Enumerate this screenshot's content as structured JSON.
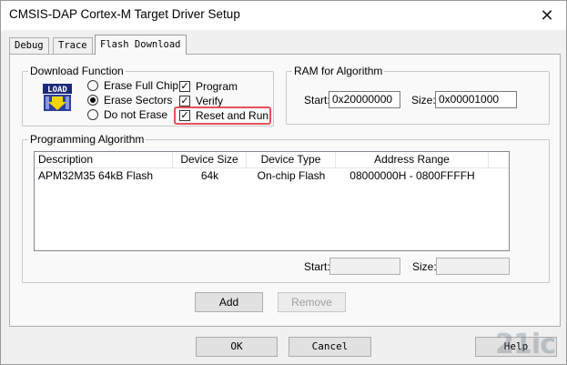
{
  "window": {
    "title": "CMSIS-DAP Cortex-M Target Driver Setup",
    "close_glyph": "✕"
  },
  "tabs": [
    {
      "label": "Debug",
      "active": false
    },
    {
      "label": "Trace",
      "active": false
    },
    {
      "label": "Flash Download",
      "active": true
    }
  ],
  "download_function": {
    "group_label": "Download Function",
    "icon_text": "LOAD",
    "radios": [
      {
        "label": "Erase Full Chip",
        "checked": false
      },
      {
        "label": "Erase Sectors",
        "checked": true
      },
      {
        "label": "Do not Erase",
        "checked": false
      }
    ],
    "checkboxes": [
      {
        "label": "Program",
        "checked": true
      },
      {
        "label": "Verify",
        "checked": true
      },
      {
        "label": "Reset and Run",
        "checked": true
      }
    ],
    "check_glyph": "✓"
  },
  "ram_for_algorithm": {
    "group_label": "RAM for Algorithm",
    "start_label": "Start:",
    "start_value": "0x20000000",
    "size_label": "Size:",
    "size_value": "0x00001000"
  },
  "programming_algorithm": {
    "group_label": "Programming Algorithm",
    "columns": [
      "Description",
      "Device Size",
      "Device Type",
      "Address Range"
    ],
    "rows": [
      [
        "APM32M35 64kB Flash",
        "64k",
        "On-chip Flash",
        "08000000H - 0800FFFFH"
      ]
    ],
    "start_label": "Start:",
    "size_label": "Size:"
  },
  "buttons": {
    "add": "Add",
    "remove": "Remove",
    "ok": "OK",
    "cancel": "Cancel",
    "help": "Help"
  },
  "watermark": "21ic"
}
